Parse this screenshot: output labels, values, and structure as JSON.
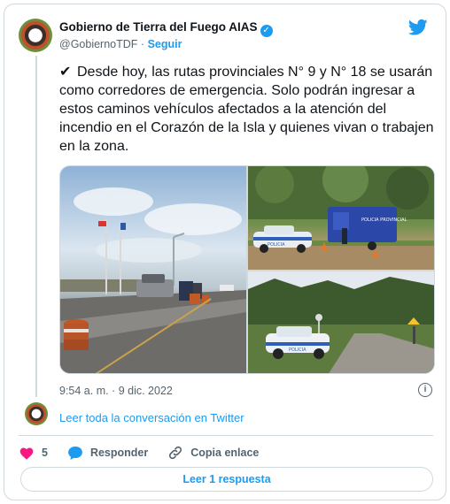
{
  "author": {
    "name": "Gobierno de Tierra del Fuego AIAS",
    "handle": "@GobiernoTDF",
    "separator": "·",
    "follow_label": "Seguir"
  },
  "tweet": {
    "check_glyph": "✔",
    "text": "Desde hoy, las rutas provinciales N° 9 y N° 18 se usarán como corredores de emergencia. Solo podrán ingresar a estos caminos  vehículos afectados a la atención del incendio en el Corazón de la Isla y quienes vivan o trabajen en la zona.",
    "timestamp": "9:54 a. m. · 9 dic. 2022"
  },
  "media": {
    "photo1_sign": "POLICIA",
    "photo2_sign": "POLICIA PROVINCIAL",
    "photo3_sign": "POLICIA"
  },
  "thread": {
    "read_conversation": "Leer toda la conversación en Twitter"
  },
  "actions": {
    "like_count": "5",
    "reply_label": "Responder",
    "copy_label": "Copia enlace"
  },
  "footer": {
    "read_replies": "Leer 1 respuesta"
  },
  "colors": {
    "accent": "#1d9bf0",
    "like": "#f91880",
    "muted": "#536471"
  }
}
